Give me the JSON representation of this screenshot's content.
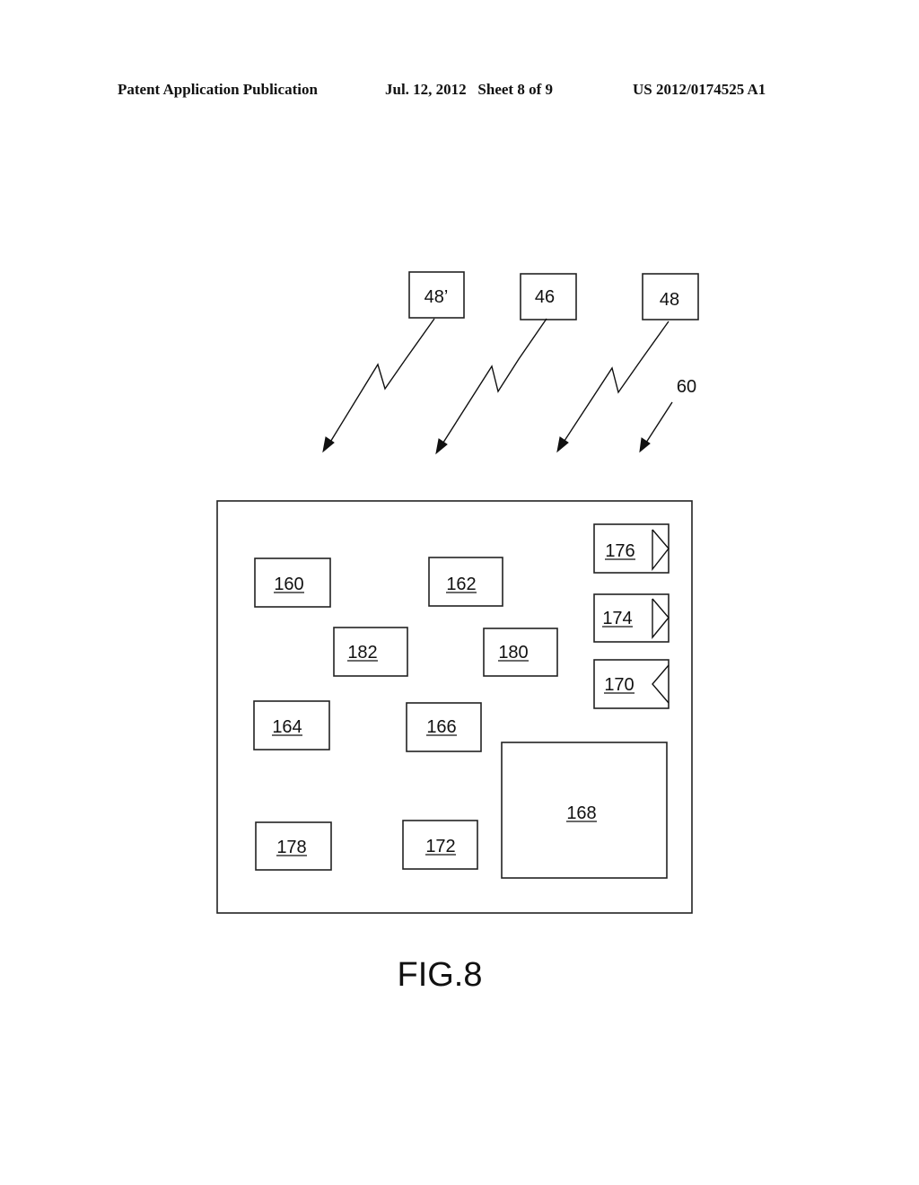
{
  "header": {
    "left": "Patent Application Publication",
    "middle": "Jul. 12, 2012   Sheet 8 of 9",
    "right": "US 2012/0174525 A1"
  },
  "figure": {
    "caption": "FIG.8",
    "sources": [
      {
        "label": "48’",
        "link": "zigzag-arrow"
      },
      {
        "label": "46",
        "link": "zigzag-arrow"
      },
      {
        "label": "48",
        "link": "zigzag-arrow"
      }
    ],
    "device_ref": "60",
    "device_components": [
      {
        "label": "160",
        "underlined": true
      },
      {
        "label": "162",
        "underlined": true
      },
      {
        "label": "182",
        "underlined": true
      },
      {
        "label": "180",
        "underlined": true
      },
      {
        "label": "164",
        "underlined": true
      },
      {
        "label": "166",
        "underlined": true
      },
      {
        "label": "178",
        "underlined": true
      },
      {
        "label": "172",
        "underlined": true
      },
      {
        "label": "168",
        "underlined": true
      },
      {
        "label": "176",
        "underlined": true,
        "indicator": "triangle-right"
      },
      {
        "label": "174",
        "underlined": true,
        "indicator": "triangle-right"
      },
      {
        "label": "170",
        "underlined": true,
        "indicator": "triangle-left"
      }
    ]
  }
}
